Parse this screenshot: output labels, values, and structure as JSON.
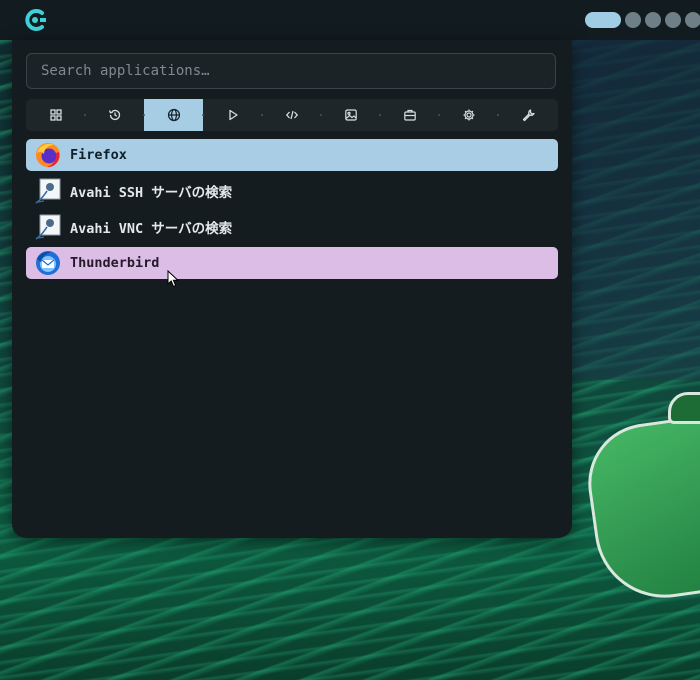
{
  "search": {
    "placeholder": "Search applications…"
  },
  "categories": [
    {
      "name": "all-apps",
      "icon": "grid-icon",
      "active": false
    },
    {
      "name": "recent",
      "icon": "history-icon",
      "active": false
    },
    {
      "name": "internet",
      "icon": "globe-icon",
      "active": true
    },
    {
      "name": "multimedia",
      "icon": "play-icon",
      "active": false
    },
    {
      "name": "development",
      "icon": "code-icon",
      "active": false
    },
    {
      "name": "graphics",
      "icon": "image-icon",
      "active": false
    },
    {
      "name": "office",
      "icon": "briefcase-icon",
      "active": false
    },
    {
      "name": "settings",
      "icon": "gear-icon",
      "active": false
    },
    {
      "name": "system-tools",
      "icon": "wrench-icon",
      "active": false
    }
  ],
  "apps": [
    {
      "label": "Firefox",
      "icon": "firefox-icon",
      "state": "selected"
    },
    {
      "label": "Avahi SSH サーバの検索",
      "icon": "avahi-icon",
      "state": "normal"
    },
    {
      "label": "Avahi VNC サーバの検索",
      "icon": "avahi-icon",
      "state": "normal"
    },
    {
      "label": "Thunderbird",
      "icon": "thunderbird-icon",
      "state": "hover"
    }
  ],
  "colors": {
    "accent_selected": "#a8cde4",
    "accent_hover": "#dbbde5",
    "panel_bg": "#151c1f",
    "topbar_bg": "#121b1f"
  }
}
